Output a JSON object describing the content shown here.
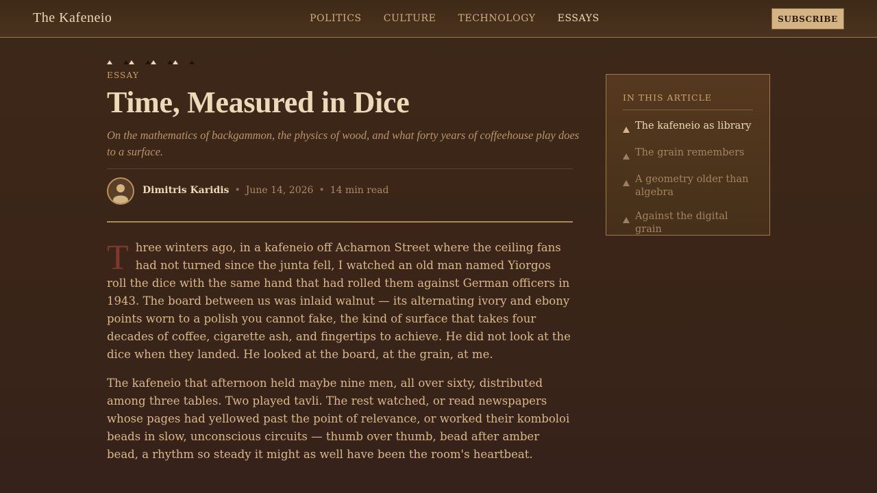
{
  "site": {
    "brand": "The Kafeneio"
  },
  "nav": {
    "items": [
      {
        "label": "POLITICS"
      },
      {
        "label": "CULTURE"
      },
      {
        "label": "TECHNOLOGY"
      },
      {
        "label": "ESSAYS",
        "active": true
      }
    ]
  },
  "header": {
    "subscribe_label": "SUBSCRIBE"
  },
  "decoration": {
    "icon": "backgammon-points-icon"
  },
  "article": {
    "eyebrow": "ESSAY",
    "title": "Time, Measured in Dice",
    "dek": "On the mathematics of backgammon, the physics of wood, and what forty years of coffeehouse play does to a surface.",
    "author": "Dimitris Karidis",
    "separator": "•",
    "date": "June 14, 2026",
    "read_time": "14 min read",
    "dropcap": "T",
    "paragraph1_rest": "hree winters ago, in a kafeneio off Acharnon Street where the ceiling fans had not turned since the junta fell, I watched an old man named Yiorgos roll the dice with the same hand that had rolled them against German officers in 1943. The board between us was inlaid walnut — its alternating ivory and ebony points worn to a polish you cannot fake, the kind of surface that takes four decades of coffee, cigarette ash, and fingertips to achieve. He did not look at the dice when they landed. He looked at the board, at the grain, at me.",
    "paragraph2": "The kafeneio that afternoon held maybe nine men, all over sixty, distributed among three tables. Two played tavli. The rest watched, or read newspapers whose pages had yellowed past the point of relevance, or worked their komboloi beads in slow, unconscious circuits — thumb over thumb, bead after amber bead, a rhythm so steady it might as well have been the room's heartbeat."
  },
  "toc": {
    "title": "IN THIS ARTICLE",
    "items": [
      {
        "label": "The kafeneio as library",
        "active": true
      },
      {
        "label": "The grain remembers"
      },
      {
        "label": "A geometry older than algebra"
      },
      {
        "label": "Against the digital grain"
      }
    ]
  },
  "colors": {
    "background": "#3a2518",
    "accent_gold": "#d4b483",
    "heading": "#ecd9b8",
    "body_text": "#d9b98a",
    "dropcap": "#7d3a2c"
  }
}
